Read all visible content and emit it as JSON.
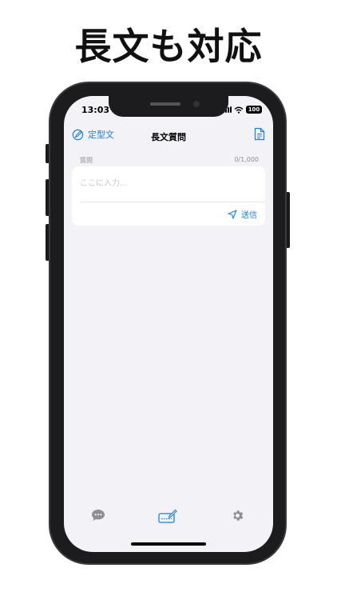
{
  "headline": "長文も対応",
  "status_bar": {
    "time": "13:03",
    "battery": "100"
  },
  "nav": {
    "left_label": "定型文",
    "title": "長文質問"
  },
  "form": {
    "label": "質問",
    "counter": "0/1,000",
    "input_value": "",
    "placeholder": "ここに入力...",
    "send_label": "送信"
  },
  "colors": {
    "accent": "#1a7fd6",
    "background": "#f2f2f7",
    "inactive_icon": "#8e8e93"
  },
  "tabs": [
    {
      "icon": "chat-bubble-icon",
      "active": false
    },
    {
      "icon": "compose-keyboard-icon",
      "active": true
    },
    {
      "icon": "gear-icon",
      "active": false
    }
  ]
}
